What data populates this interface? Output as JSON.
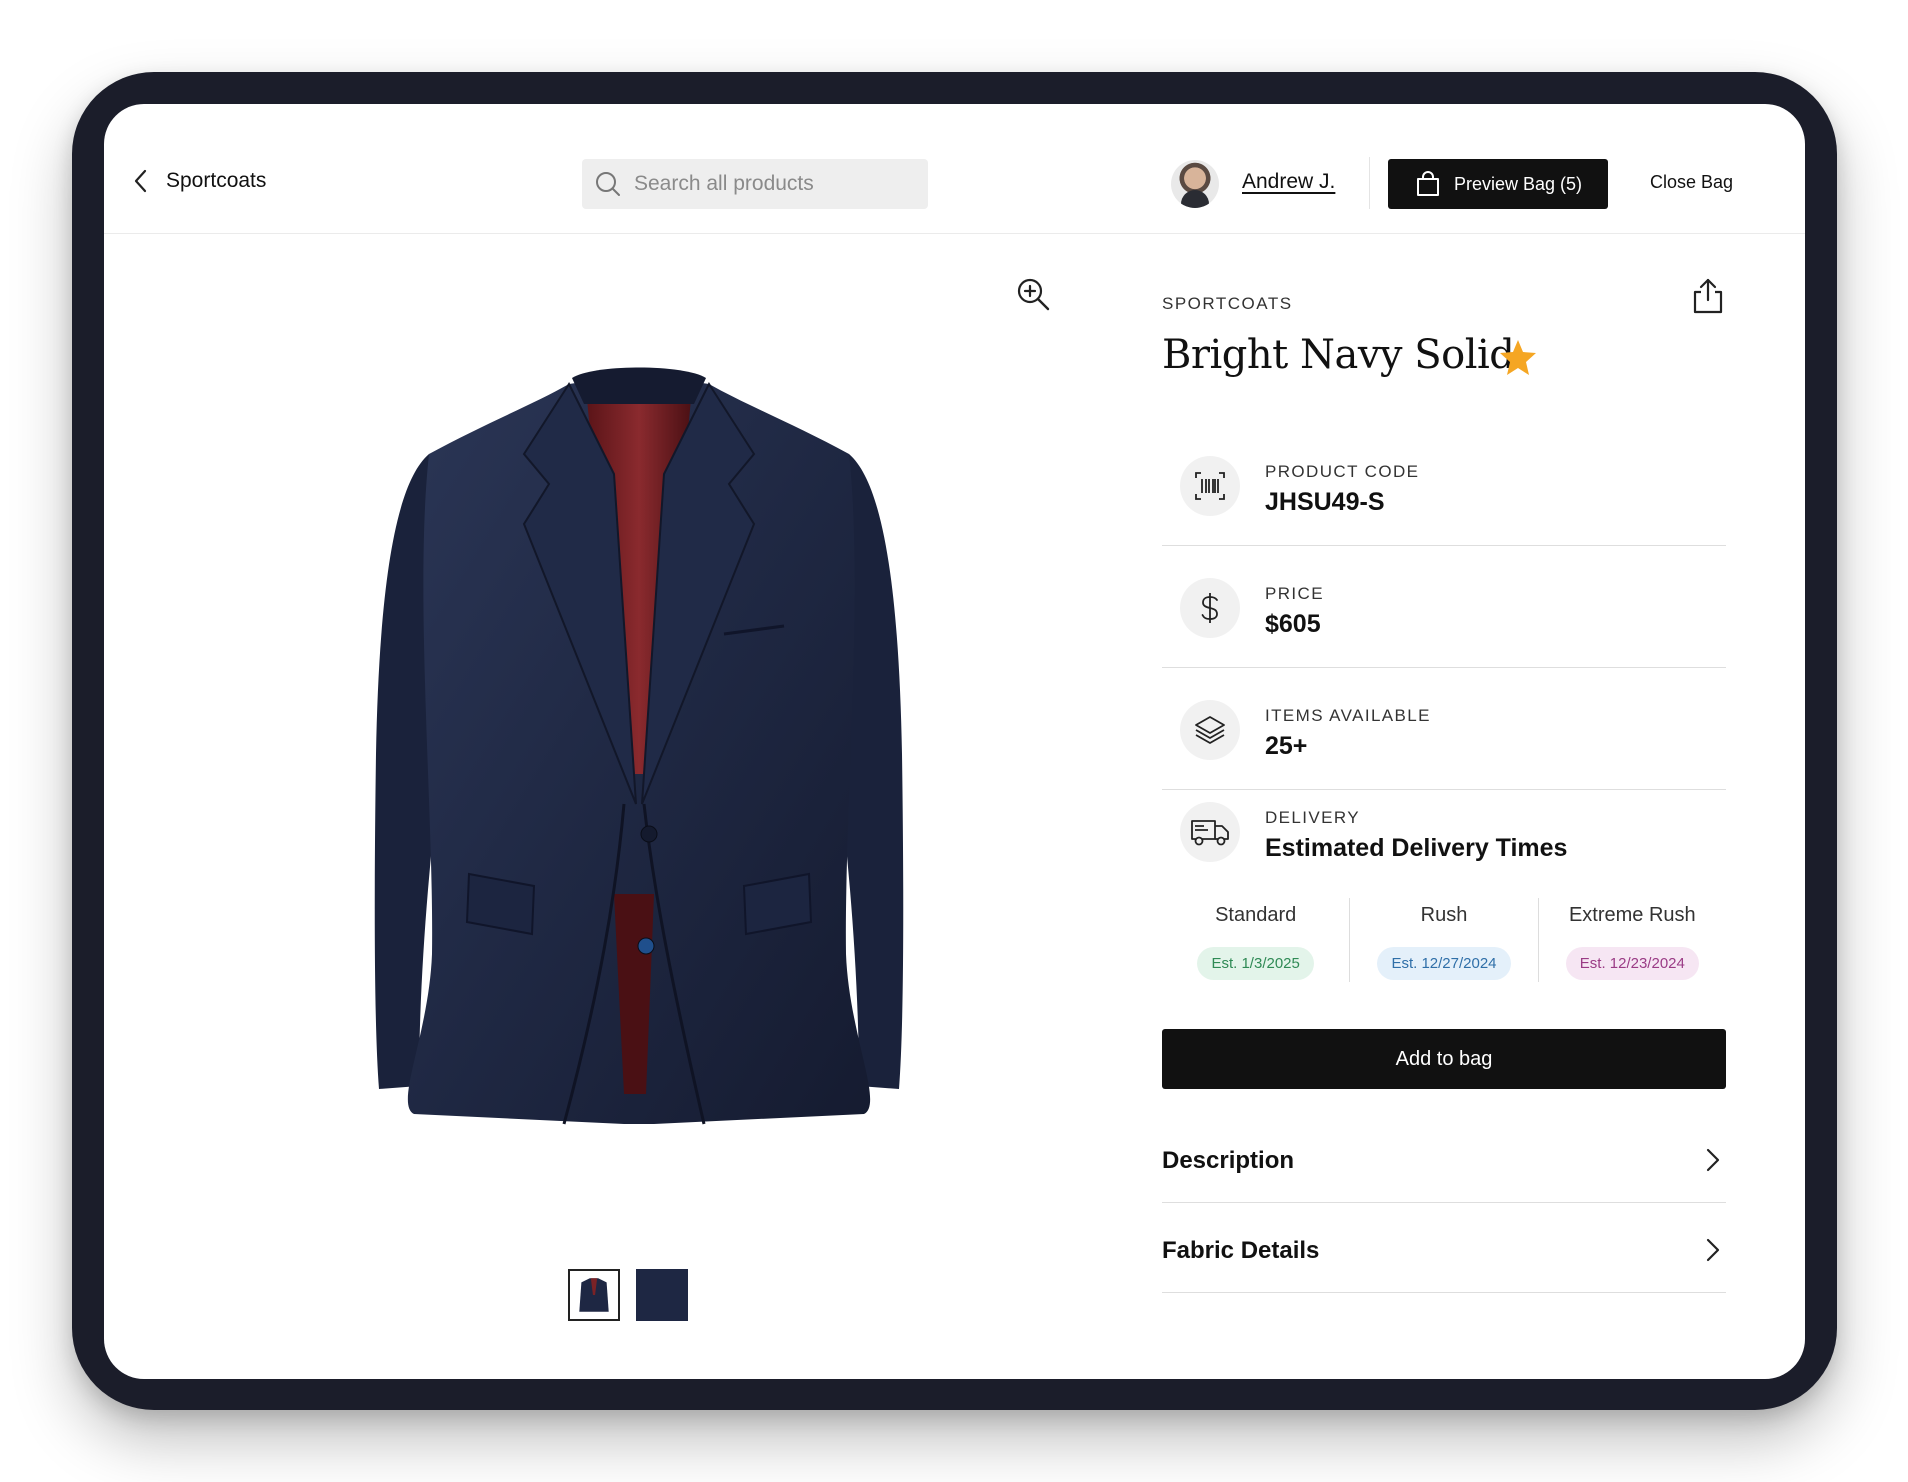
{
  "header": {
    "back_label": "Sportcoats",
    "search_placeholder": "Search all products",
    "user_name": "Andrew J.",
    "bag_label": "Preview Bag (5)",
    "close_label": "Close Bag"
  },
  "product": {
    "category": "SPORTCOATS",
    "name": "Bright Navy Solid",
    "favorite": true,
    "star_color": "#f5a623",
    "thumbnails": [
      {
        "name": "jacket-front",
        "selected": true
      },
      {
        "name": "fabric-swatch",
        "selected": false
      }
    ]
  },
  "details": {
    "code": {
      "label": "PRODUCT CODE",
      "value": "JHSU49-S",
      "icon": "barcode-icon"
    },
    "price": {
      "label": "PRICE",
      "value": "$605",
      "icon": "dollar-icon"
    },
    "stock": {
      "label": "ITEMS AVAILABLE",
      "value": "25+",
      "icon": "layers-icon"
    }
  },
  "delivery": {
    "label": "DELIVERY",
    "title": "Estimated Delivery Times",
    "icon": "truck-icon",
    "options": [
      {
        "name": "Standard",
        "estimate": "Est. 1/3/2025",
        "bg": "#e3f4ea",
        "fg": "#2f8a55"
      },
      {
        "name": "Rush",
        "estimate": "Est. 12/27/2024",
        "bg": "#e4f0fa",
        "fg": "#2f6fa8"
      },
      {
        "name": "Extreme Rush",
        "estimate": "Est. 12/23/2024",
        "bg": "#f6e6f3",
        "fg": "#9a3b85"
      }
    ]
  },
  "actions": {
    "add_to_bag": "Add to bag"
  },
  "accordions": [
    {
      "label": "Description"
    },
    {
      "label": "Fabric Details"
    }
  ]
}
